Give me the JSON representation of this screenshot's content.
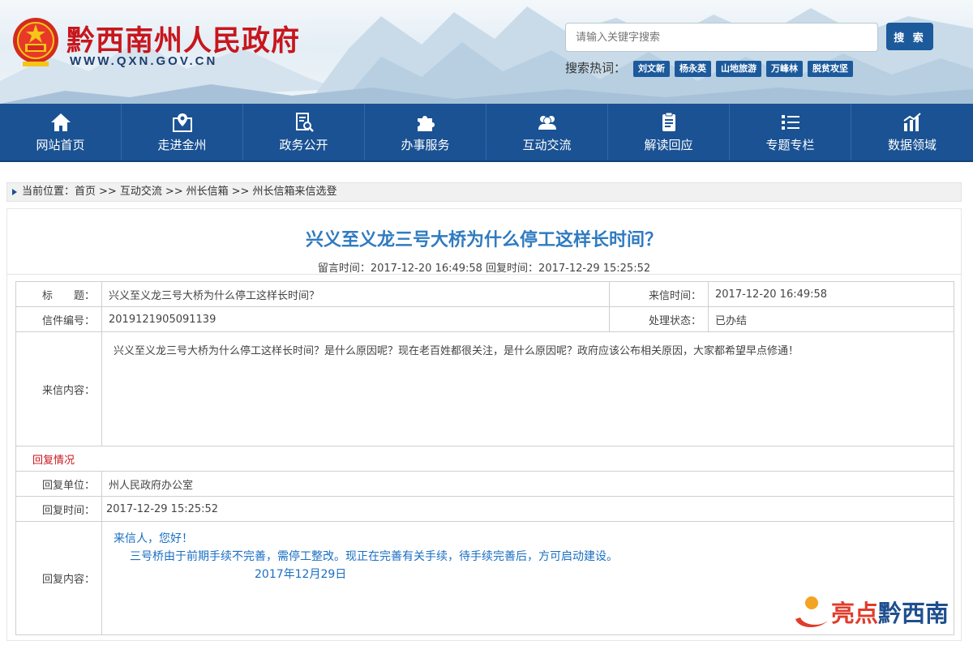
{
  "header": {
    "site_title": "黔西南州人民政府",
    "site_url": "WWW.QXN.GOV.CN",
    "search_placeholder": "请输入关键字搜索",
    "search_button": "搜 索",
    "hot_label": "搜索热词：",
    "hot_tags": [
      "刘文新",
      "杨永英",
      "山地旅游",
      "万峰林",
      "脱贫攻坚"
    ]
  },
  "nav": {
    "items": [
      {
        "label": "网站首页",
        "icon": "home-icon"
      },
      {
        "label": "走进金州",
        "icon": "map-pin-icon"
      },
      {
        "label": "政务公开",
        "icon": "document-search-icon"
      },
      {
        "label": "办事服务",
        "icon": "puzzle-icon"
      },
      {
        "label": "互动交流",
        "icon": "people-icon"
      },
      {
        "label": "解读回应",
        "icon": "clipboard-icon"
      },
      {
        "label": "专题专栏",
        "icon": "list-icon"
      },
      {
        "label": "数据领域",
        "icon": "chart-icon"
      }
    ]
  },
  "breadcrumb": {
    "prefix": "当前位置：",
    "items": [
      "首页",
      "互动交流",
      "州长信箱",
      "州长信箱来信选登"
    ],
    "separator": ">>"
  },
  "article": {
    "title": "兴义至义龙三号大桥为什么停工这样长时间？",
    "meta": "留言时间：2017-12-20 16:49:58 回复时间：2017-12-29 15:25:52"
  },
  "letter": {
    "title_label": "标　　题：",
    "title_value": "兴义至义龙三号大桥为什么停工这样长时间？",
    "sent_time_label": "来信时间：",
    "sent_time_value": "2017-12-20 16:49:58",
    "number_label": "信件编号：",
    "number_value": "2019121905091139",
    "status_label": "处理状态：",
    "status_value": "已办结",
    "content_label": "来信内容：",
    "content_value": "兴义至义龙三号大桥为什么停工这样长时间？是什么原因呢？现在老百姓都很关注，是什么原因呢？政府应该公布相关原因，大家都希望早点修通！"
  },
  "reply": {
    "section_label": "回复情况",
    "unit_label": "回复单位：",
    "unit_value": "州人民政府办公室",
    "time_label": "回复时间：",
    "time_value": "2017-12-29 15:25:52",
    "content_label": "回复内容：",
    "greeting": "来信人，您好！",
    "body": "三号桥由于前期手续不完善，需停工整改。现正在完善有关手续，待手续完善后，方可启动建设。",
    "date": "2017年12月29日"
  },
  "watermark": {
    "text_a": "亮点",
    "text_b": "黔西南"
  },
  "colors": {
    "nav_bg": "#1a5293",
    "title_blue": "#2f7bc0",
    "brand_red": "#c8161d",
    "reply_blue": "#1a6ec2"
  }
}
